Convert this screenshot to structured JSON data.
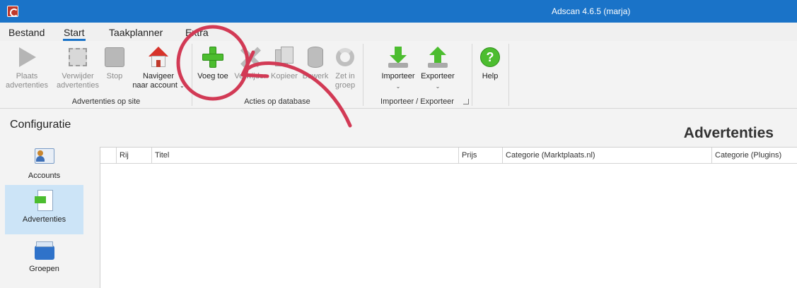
{
  "window": {
    "title": "Adscan 4.6.5 (marja)",
    "icon": "app-logo-icon"
  },
  "menu": {
    "tabs": [
      {
        "label": "Bestand",
        "active": false
      },
      {
        "label": "Start",
        "active": true
      },
      {
        "label": "Taakplanner",
        "active": false
      },
      {
        "label": "Extra",
        "active": false
      }
    ]
  },
  "ribbon": {
    "groups": [
      {
        "label": "Advertenties op site",
        "buttons": [
          {
            "line1": "Plaats",
            "line2": "advertenties",
            "icon": "play-icon",
            "enabled": false
          },
          {
            "line1": "Verwijder",
            "line2": "advertenties",
            "icon": "remove-ads-icon",
            "enabled": false
          },
          {
            "line1": "Stop",
            "line2": "",
            "icon": "stop-icon",
            "enabled": false
          },
          {
            "line1": "Navigeer",
            "line2": "naar account",
            "icon": "house-icon",
            "enabled": true,
            "dropdown": true
          }
        ]
      },
      {
        "label": "Acties op database",
        "buttons": [
          {
            "line1": "Voeg toe",
            "line2": "",
            "icon": "plus-icon",
            "enabled": true
          },
          {
            "line1": "Verwijder",
            "line2": "",
            "icon": "delete-x-icon",
            "enabled": false
          },
          {
            "line1": "Kopieer",
            "line2": "",
            "icon": "copy-icon",
            "enabled": false
          },
          {
            "line1": "Bewerk",
            "line2": "",
            "icon": "database-edit-icon",
            "enabled": false
          },
          {
            "line1": "Zet in",
            "line2": "groep",
            "icon": "group-cycle-icon",
            "enabled": false
          }
        ]
      },
      {
        "label": "Importeer / Exporteer",
        "buttons": [
          {
            "line1": "Importeer",
            "line2": "",
            "icon": "import-icon",
            "enabled": true,
            "dropdown": true
          },
          {
            "line1": "Exporteer",
            "line2": "",
            "icon": "export-icon",
            "enabled": true,
            "dropdown": true
          }
        ]
      },
      {
        "label": "",
        "buttons": [
          {
            "line1": "Help",
            "line2": "",
            "icon": "help-icon",
            "enabled": true
          }
        ]
      }
    ]
  },
  "nav": {
    "title": "Configuratie",
    "items": [
      {
        "label": "Accounts",
        "icon": "accounts-icon",
        "selected": false
      },
      {
        "label": "Advertenties",
        "icon": "advertisements-icon",
        "selected": true
      },
      {
        "label": "Groepen",
        "icon": "groups-icon",
        "selected": false
      }
    ]
  },
  "main": {
    "heading": "Advertenties",
    "grid": {
      "columns": [
        "",
        "Rij",
        "Titel",
        "Prijs",
        "Categorie (Marktplaats.nl)",
        "Categorie (Plugins)"
      ],
      "rows": []
    }
  },
  "colors": {
    "titlebar": "#1a73c8",
    "selected_nav": "#cce4f7",
    "annotation": "#d23a55",
    "accent_green": "#4cbd2f"
  }
}
